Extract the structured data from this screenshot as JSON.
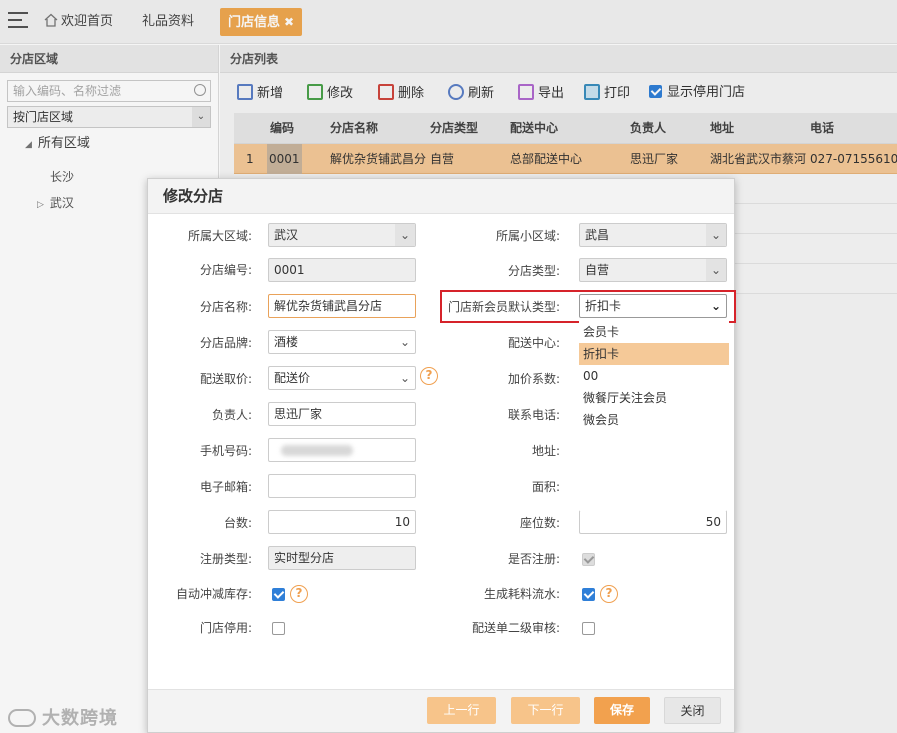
{
  "topbar": {
    "tabs": [
      "欢迎首页",
      "礼品资料",
      "门店信息"
    ],
    "close_glyph": "✖"
  },
  "left_panel": {
    "title": "分店区域",
    "filter_placeholder": "输入编码、名称过滤",
    "area_select": "按门店区域",
    "tree_root": "所有区域",
    "tree_children": [
      "长沙",
      "武汉"
    ]
  },
  "right_panel": {
    "title": "分店列表",
    "toolbar": [
      "新增",
      "修改",
      "删除",
      "刷新",
      "导出",
      "打印",
      "显示停用门店"
    ],
    "show_stopped_checked": true,
    "grid_headers": [
      "编码",
      "分店名称",
      "分店类型",
      "配送中心",
      "负责人",
      "地址",
      "电话"
    ],
    "grid_row": {
      "index": "1",
      "code": "0001",
      "name": "解优杂货铺武昌分",
      "type": "自营",
      "center": "总部配送中心",
      "manager": "思迅厂家",
      "address": "湖北省武汉市蔡河",
      "phone": "027-07155610"
    }
  },
  "dialog": {
    "title": "修改分店",
    "left_labels": [
      "所属大区域:",
      "分店编号:",
      "分店名称:",
      "分店品牌:",
      "配送取价:",
      "负责人:",
      "手机号码:",
      "电子邮箱:",
      "台数:",
      "注册类型:",
      "自动冲减库存:",
      "门店停用:"
    ],
    "right_labels": [
      "所属小区域:",
      "分店类型:",
      "门店新会员默认类型:",
      "配送中心:",
      "加价系数:",
      "联系电话:",
      "地址:",
      "面积:",
      "座位数:",
      "是否注册:",
      "生成耗料流水:",
      "配送单二级审核:"
    ],
    "values": {
      "big_area": "武汉",
      "branch_no": "0001",
      "branch_name": "解优杂货铺武昌分店",
      "brand": "酒楼",
      "price_mode": "配送价",
      "manager": "思迅厂家",
      "mobile": "",
      "email": "",
      "counters": "10",
      "reg_type": "实时型分店",
      "small_area": "武昌",
      "branch_type": "自营",
      "member_type": "折扣卡",
      "seats": "50"
    },
    "member_type_options": [
      "会员卡",
      "折扣卡",
      "00",
      "微餐厅关注会员",
      "微会员"
    ],
    "member_type_selected_index": 1,
    "checkboxes": {
      "auto_deduct_stock": true,
      "store_disabled": false,
      "is_registered": true,
      "gen_consume_flow": true,
      "delivery_second_audit": false
    },
    "help_glyph": "?",
    "dropdown_glyph": "⌄",
    "buttons": [
      "上一行",
      "下一行",
      "保存",
      "关闭"
    ]
  },
  "watermark": "大数跨境",
  "colors": {
    "accent": "#f0a850",
    "row_highlight": "#f5c998",
    "red_outline": "#d6232a",
    "checkbox_blue": "#2f7fd8"
  }
}
